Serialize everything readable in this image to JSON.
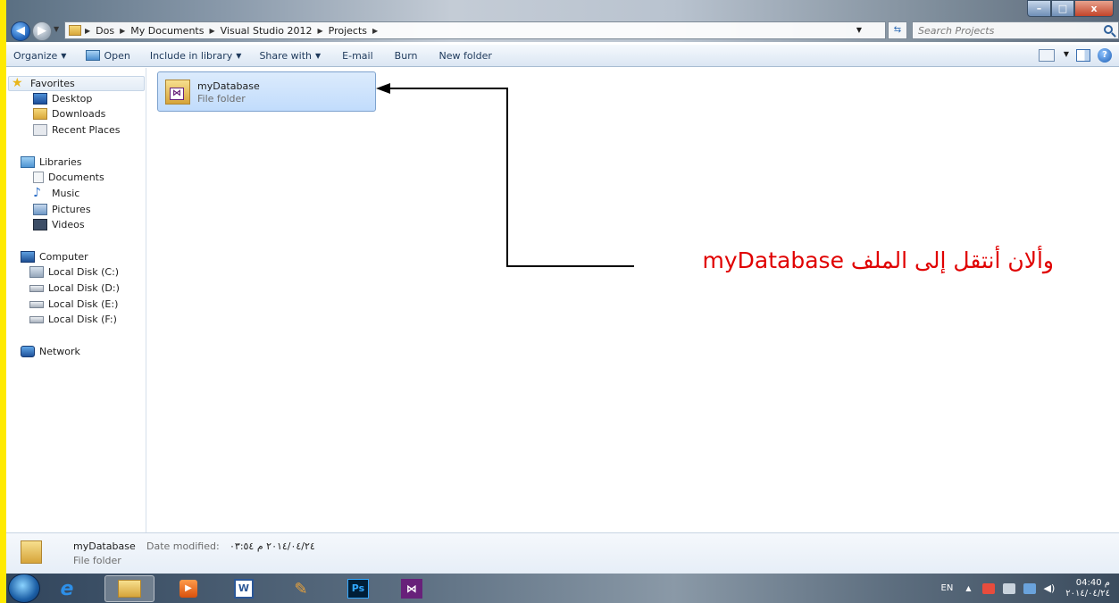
{
  "window": {
    "controls": {
      "minimize": "–",
      "maximize": "□",
      "close": "x"
    }
  },
  "address": {
    "crumbs": [
      "Dos",
      "My Documents",
      "Visual Studio 2012",
      "Projects"
    ],
    "search_placeholder": "Search Projects"
  },
  "toolbar": {
    "organize": "Organize",
    "open": "Open",
    "include_in_library": "Include in library",
    "share_with": "Share with",
    "email": "E-mail",
    "burn": "Burn",
    "new_folder": "New folder"
  },
  "nav": {
    "favorites": "Favorites",
    "desktop": "Desktop",
    "downloads": "Downloads",
    "recent_places": "Recent Places",
    "libraries": "Libraries",
    "documents": "Documents",
    "music": "Music",
    "pictures": "Pictures",
    "videos": "Videos",
    "computer": "Computer",
    "disk_c": "Local Disk (C:)",
    "disk_d": "Local Disk (D:)",
    "disk_e": "Local Disk (E:)",
    "disk_f": "Local Disk (F:)",
    "network": "Network"
  },
  "content": {
    "folder": {
      "name": "myDatabase",
      "type": "File folder"
    },
    "annotation": "وألان أنتقل إلى الملف myDatabase",
    "annotation_color": "#e00000"
  },
  "details": {
    "name": "myDatabase",
    "date_label": "Date modified:",
    "date_value": "٢٠١٤/٠٤/٢٤ م ٠٣:٥٤",
    "type": "File folder"
  },
  "taskbar": {
    "lang": "EN",
    "clock_time": "04:40 م",
    "clock_date": "٢٠١٤/٠٤/٢٤",
    "apps": {
      "ps": "Ps",
      "vs": "⋈",
      "word": "W",
      "media": "▶"
    }
  },
  "colors": {
    "highlight_bar": "#ffea00",
    "selection": "#cce2fb"
  }
}
